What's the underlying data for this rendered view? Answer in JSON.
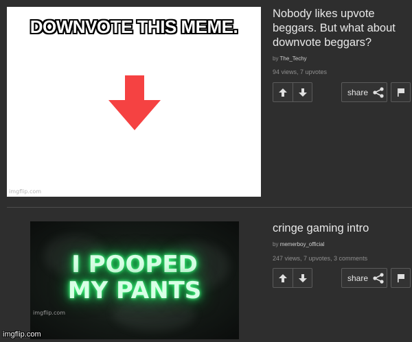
{
  "posts": [
    {
      "title": "Nobody likes upvote beggars. But what about downvote beggars?",
      "by_prefix": "by",
      "username": "The_Techy",
      "stats": "94 views, 7 upvotes",
      "image": {
        "caption": "DOWNVOTE THIS MEME.",
        "watermark": "imgflip.com",
        "arrow_color": "#f54242",
        "icon": "down-arrow-icon"
      },
      "share_label": "share"
    },
    {
      "title": "cringe gaming intro",
      "by_prefix": "by",
      "username": "memerboy_official",
      "stats": "247 views, 7 upvotes, 3 comments",
      "image": {
        "line1": "I POOPED",
        "line2": "MY PANTS",
        "watermark": "imgflip.com",
        "glow_color": "#23e063"
      },
      "share_label": "share"
    }
  ],
  "footer_watermark": "imgflip.com",
  "colors": {
    "background": "#2e2e2e",
    "text": "#e8e8e8",
    "muted": "#8f8f8f",
    "border": "#5b5b5b"
  }
}
